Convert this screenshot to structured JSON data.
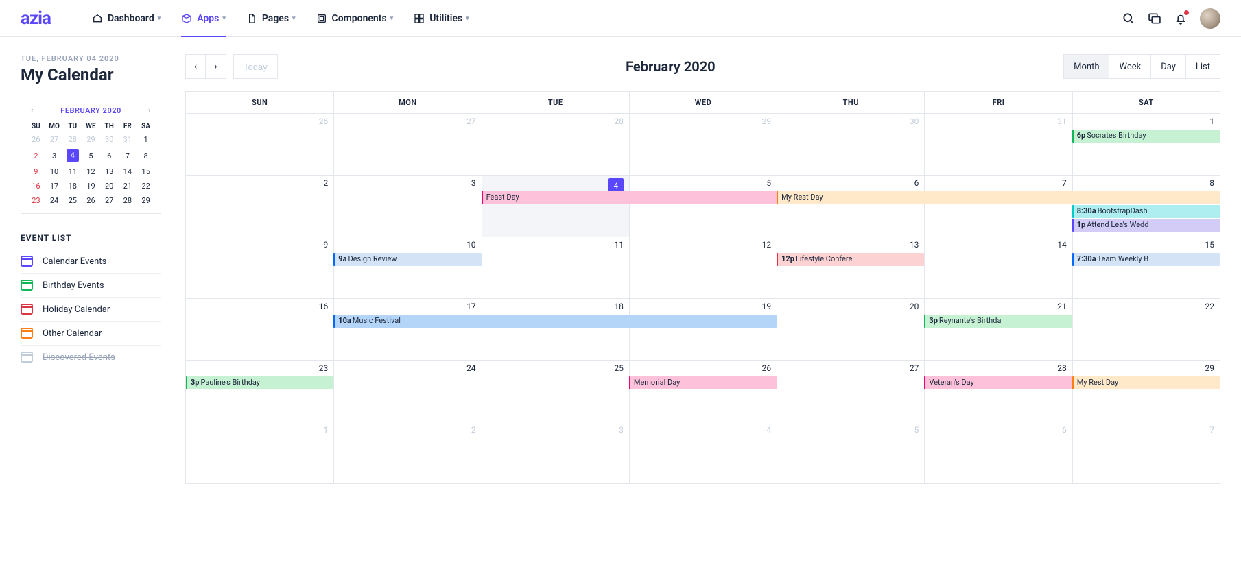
{
  "brand": "azia",
  "nav": {
    "items": [
      {
        "label": "Dashboard",
        "active": false,
        "icon": "dashboard-icon"
      },
      {
        "label": "Apps",
        "active": true,
        "icon": "apps-icon"
      },
      {
        "label": "Pages",
        "active": false,
        "icon": "pages-icon"
      },
      {
        "label": "Components",
        "active": false,
        "icon": "components-icon"
      },
      {
        "label": "Utilities",
        "active": false,
        "icon": "utilities-icon"
      }
    ]
  },
  "sidebar": {
    "date_line": "TUE, FEBRUARY 04 2020",
    "title": "My Calendar",
    "minical": {
      "title": "FEBRUARY 2020",
      "dow": [
        "SU",
        "MO",
        "TU",
        "WE",
        "TH",
        "FR",
        "SA"
      ],
      "weeks": [
        [
          {
            "n": 26,
            "other": true
          },
          {
            "n": 27,
            "other": true
          },
          {
            "n": 28,
            "other": true
          },
          {
            "n": 29,
            "other": true
          },
          {
            "n": 30,
            "other": true
          },
          {
            "n": 31,
            "other": true
          },
          {
            "n": 1
          }
        ],
        [
          {
            "n": 2,
            "sun": true
          },
          {
            "n": 3
          },
          {
            "n": 4,
            "selected": true
          },
          {
            "n": 5
          },
          {
            "n": 6
          },
          {
            "n": 7
          },
          {
            "n": 8
          }
        ],
        [
          {
            "n": 9,
            "sun": true
          },
          {
            "n": 10
          },
          {
            "n": 11
          },
          {
            "n": 12
          },
          {
            "n": 13
          },
          {
            "n": 14
          },
          {
            "n": 15
          }
        ],
        [
          {
            "n": 16,
            "sun": true
          },
          {
            "n": 17
          },
          {
            "n": 18
          },
          {
            "n": 19
          },
          {
            "n": 20
          },
          {
            "n": 21
          },
          {
            "n": 22
          }
        ],
        [
          {
            "n": 23,
            "sun": true
          },
          {
            "n": 24
          },
          {
            "n": 25
          },
          {
            "n": 26
          },
          {
            "n": 27
          },
          {
            "n": 28
          },
          {
            "n": 29
          }
        ]
      ]
    },
    "eventlist_title": "EVENT LIST",
    "eventlist": [
      {
        "label": "Calendar Events",
        "color": "#5b47fb"
      },
      {
        "label": "Birthday Events",
        "color": "#10b759"
      },
      {
        "label": "Holiday Calendar",
        "color": "#dc3545"
      },
      {
        "label": "Other Calendar",
        "color": "#fd7e14"
      },
      {
        "label": "Discovered Events",
        "color": "#c0ccda",
        "struck": true
      }
    ]
  },
  "calendar": {
    "today_label": "Today",
    "title": "February 2020",
    "views": [
      {
        "label": "Month",
        "active": true
      },
      {
        "label": "Week"
      },
      {
        "label": "Day"
      },
      {
        "label": "List"
      }
    ],
    "dow": [
      "SUN",
      "MON",
      "TUE",
      "WED",
      "THU",
      "FRI",
      "SAT"
    ],
    "rows": [
      {
        "days": [
          {
            "n": 26,
            "other": true
          },
          {
            "n": 27,
            "other": true
          },
          {
            "n": 28,
            "other": true
          },
          {
            "n": 29,
            "other": true
          },
          {
            "n": 30,
            "other": true
          },
          {
            "n": 31,
            "other": true
          },
          {
            "n": 1
          }
        ],
        "events": [
          {
            "startCol": 6,
            "span": 1,
            "rowOffset": 0,
            "time": "6p",
            "title": "Socrates Birthday",
            "cls": "c-green"
          }
        ]
      },
      {
        "days": [
          {
            "n": 2
          },
          {
            "n": 3
          },
          {
            "n": 4,
            "today": true
          },
          {
            "n": 5
          },
          {
            "n": 6
          },
          {
            "n": 7
          },
          {
            "n": 8
          }
        ],
        "events": [
          {
            "startCol": 2,
            "span": 2,
            "rowOffset": 0,
            "time": "",
            "title": "Feast Day",
            "cls": "c-pink"
          },
          {
            "startCol": 4,
            "span": 3,
            "rowOffset": 0,
            "time": "",
            "title": "My Rest Day",
            "cls": "c-orange"
          },
          {
            "startCol": 6,
            "span": 1,
            "rowOffset": 1,
            "time": "8:30a",
            "title": "BootstrapDash",
            "cls": "c-teal"
          },
          {
            "startCol": 6,
            "span": 1,
            "rowOffset": 2,
            "time": "1p",
            "title": "Attend Lea's Wedd",
            "cls": "c-purple"
          }
        ]
      },
      {
        "days": [
          {
            "n": 9
          },
          {
            "n": 10
          },
          {
            "n": 11
          },
          {
            "n": 12
          },
          {
            "n": 13
          },
          {
            "n": 14
          },
          {
            "n": 15
          }
        ],
        "events": [
          {
            "startCol": 1,
            "span": 1,
            "rowOffset": 0,
            "time": "9a",
            "title": "Design Review",
            "cls": "c-blue"
          },
          {
            "startCol": 4,
            "span": 1,
            "rowOffset": 0,
            "time": "12p",
            "title": "Lifestyle Confere",
            "cls": "c-red"
          },
          {
            "startCol": 6,
            "span": 1,
            "rowOffset": 0,
            "time": "7:30a",
            "title": "Team Weekly B",
            "cls": "c-blue"
          }
        ]
      },
      {
        "days": [
          {
            "n": 16
          },
          {
            "n": 17
          },
          {
            "n": 18
          },
          {
            "n": 19
          },
          {
            "n": 20
          },
          {
            "n": 21
          },
          {
            "n": 22
          }
        ],
        "events": [
          {
            "startCol": 1,
            "span": 3,
            "rowOffset": 0,
            "time": "10a",
            "title": "Music Festival",
            "cls": "c-lblue"
          },
          {
            "startCol": 5,
            "span": 1,
            "rowOffset": 0,
            "time": "3p",
            "title": "Reynante's Birthda",
            "cls": "c-green"
          }
        ]
      },
      {
        "days": [
          {
            "n": 23
          },
          {
            "n": 24
          },
          {
            "n": 25
          },
          {
            "n": 26
          },
          {
            "n": 27
          },
          {
            "n": 28
          },
          {
            "n": 29
          }
        ],
        "events": [
          {
            "startCol": 0,
            "span": 1,
            "rowOffset": 0,
            "time": "3p",
            "title": "Pauline's Birthday",
            "cls": "c-green"
          },
          {
            "startCol": 3,
            "span": 1,
            "rowOffset": 0,
            "time": "",
            "title": "Memorial Day",
            "cls": "c-pink"
          },
          {
            "startCol": 5,
            "span": 1,
            "rowOffset": 0,
            "time": "",
            "title": "Veteran's Day",
            "cls": "c-pink"
          },
          {
            "startCol": 6,
            "span": 1,
            "rowOffset": 0,
            "time": "",
            "title": "My Rest Day",
            "cls": "c-orange"
          }
        ]
      },
      {
        "days": [
          {
            "n": 1,
            "other": true
          },
          {
            "n": 2,
            "other": true
          },
          {
            "n": 3,
            "other": true
          },
          {
            "n": 4,
            "other": true
          },
          {
            "n": 5,
            "other": true
          },
          {
            "n": 6,
            "other": true
          },
          {
            "n": 7,
            "other": true
          }
        ],
        "events": []
      }
    ]
  }
}
